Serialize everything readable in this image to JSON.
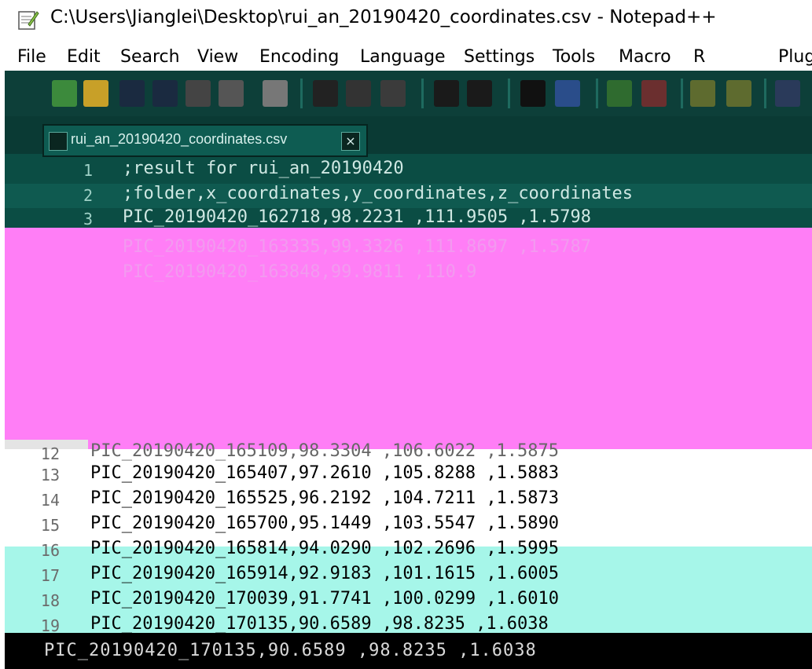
{
  "window": {
    "title": "C:\\Users\\Jianglei\\Desktop\\rui_an_20190420_coordinates.csv - Notepad++",
    "icon": "notepad-icon"
  },
  "menu": [
    "File",
    "Edit",
    "Search",
    "View",
    "Encoding",
    "Language",
    "Settings",
    "Tools",
    "Macro",
    "R",
    "Plug"
  ],
  "toolbar": {
    "buttons": [
      "new-file-icon",
      "open-file-icon",
      "save-icon",
      "save-all-icon",
      "close-icon",
      "close-all-icon",
      "print-icon",
      "cut-icon",
      "copy-icon",
      "paste-icon",
      "undo-icon",
      "redo-icon",
      "find-icon",
      "replace-icon",
      "zoom-in-icon",
      "zoom-out-icon",
      "sync-v-icon",
      "sync-h-icon",
      "wrap-icon"
    ]
  },
  "tab": {
    "label": "rui_an_20190420_coordinates.csv",
    "close": "×"
  },
  "lines_top": [
    {
      "n": "1",
      "text": ";result for rui_an_20190420"
    },
    {
      "n": "2",
      "text": ";folder,x_coordinates,y_coordinates,z_coordinates"
    },
    {
      "n": "3",
      "text": "PIC_20190420_162718,98.2231 ,111.9505 ,1.5798"
    }
  ],
  "lines_partial": [
    {
      "n": "4",
      "text": "PIC_20190420_163335,99.3326 ,111.8697 ,1.5787"
    },
    {
      "n": "5",
      "text": "PIC_20190420_163848,99.9811 ,110.9"
    }
  ],
  "lines_visible": [
    {
      "n": "12",
      "text": "PIC_20190420_165109,98.3304 ,106.6022 ,1.5875"
    },
    {
      "n": "13",
      "text": "PIC_20190420_165407,97.2610 ,105.8288 ,1.5883"
    },
    {
      "n": "14",
      "text": "PIC_20190420_165525,96.2192 ,104.7211 ,1.5873"
    },
    {
      "n": "15",
      "text": "PIC_20190420_165700,95.1449 ,103.5547 ,1.5890"
    },
    {
      "n": "16",
      "text": "PIC_20190420_165814,94.0290 ,102.2696 ,1.5995"
    }
  ],
  "lines_highlighted": [
    {
      "n": "17",
      "text": "PIC_20190420_165914,92.9183 ,101.1615 ,1.6005"
    },
    {
      "n": "18",
      "text": "PIC_20190420_170039,91.7741 ,100.0299 ,1.6010"
    },
    {
      "n": "19",
      "text": "PIC_20190420_170135,90.6589 ,98.8235 ,1.6038"
    }
  ],
  "colors": {
    "dark_band": "#0b4d44",
    "magenta_band": "#ff7ef6",
    "teal_highlight": "#a6f6e9",
    "black_band": "#000000"
  }
}
